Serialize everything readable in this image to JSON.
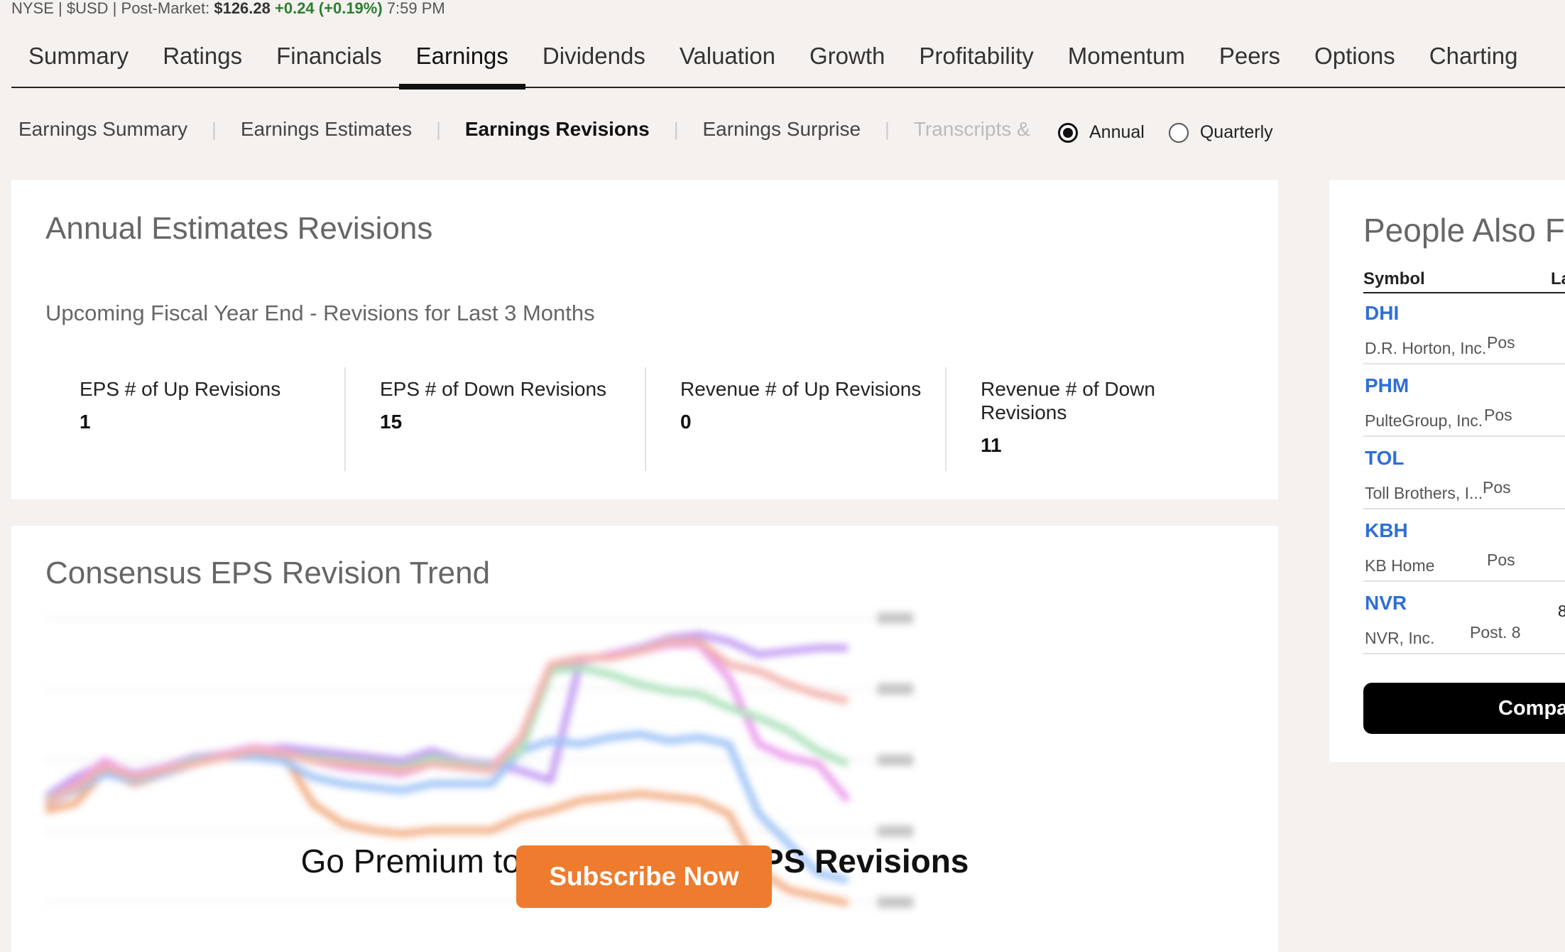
{
  "ticker": {
    "exchange": "NYSE",
    "currency": "$USD",
    "session": "Post-Market:",
    "price": "$126.28",
    "change": "+0.24 (+0.19%)",
    "time": "7:59 PM",
    "change_color": "#2e7d32"
  },
  "main_tabs": [
    "Summary",
    "Ratings",
    "Financials",
    "Earnings",
    "Dividends",
    "Valuation",
    "Growth",
    "Profitability",
    "Momentum",
    "Peers",
    "Options",
    "Charting"
  ],
  "active_main_tab": "Earnings",
  "sub_tabs": [
    "Earnings Summary",
    "Earnings Estimates",
    "Earnings Revisions",
    "Earnings Surprise",
    "Transcripts &"
  ],
  "active_sub_tab": "Earnings Revisions",
  "period_toggle": {
    "annual": "Annual",
    "quarterly": "Quarterly",
    "selected": "Annual"
  },
  "revisions": {
    "title": "Annual Estimates Revisions",
    "subtitle": "Upcoming Fiscal Year End - Revisions for Last 3 Months",
    "metrics": [
      {
        "label": "EPS # of Up Revisions",
        "value": "1"
      },
      {
        "label": "EPS # of Down Revisions",
        "value": "15"
      },
      {
        "label": "Revenue # of Up Revisions",
        "value": "0"
      },
      {
        "label": "Revenue # of Down Revisions",
        "value": "11"
      }
    ]
  },
  "trend": {
    "title": "Consensus EPS Revision Trend",
    "premium_prefix": "Go Premium to see ",
    "premium_bold": "Earnings EPS Revisions",
    "subscribe_label": "Subscribe Now",
    "accent_color": "#ef7c2e"
  },
  "chart_data": {
    "type": "line",
    "title": "Consensus EPS Revision Trend",
    "blurred": true,
    "grid": true,
    "y_ticks_visible": false,
    "series": [
      {
        "color": "#b88cf0",
        "values": [
          26,
          32,
          36,
          33,
          35,
          38,
          39,
          40,
          41,
          40,
          39,
          38,
          37,
          40,
          37,
          36,
          34,
          31,
          67,
          69,
          71,
          74,
          75,
          73,
          69,
          70,
          71,
          71
        ]
      },
      {
        "color": "#f0a070",
        "values": [
          22,
          24,
          34,
          30,
          33,
          36,
          38,
          40,
          39,
          24,
          18,
          16,
          15,
          16,
          16,
          16,
          20,
          22,
          25,
          26,
          27,
          26,
          25,
          21,
          4,
          -2,
          -4,
          -6
        ]
      },
      {
        "color": "#8db8f5",
        "values": [
          24,
          28,
          33,
          31,
          33,
          36,
          38,
          38,
          37,
          32,
          30,
          29,
          28,
          30,
          30,
          30,
          40,
          43,
          42,
          44,
          45,
          43,
          44,
          42,
          21,
          12,
          3,
          1
        ]
      },
      {
        "color": "#e88ce8",
        "values": [
          25,
          30,
          37,
          32,
          35,
          37,
          39,
          41,
          40,
          37,
          35,
          34,
          33,
          36,
          35,
          35,
          44,
          66,
          67,
          69,
          70,
          72,
          72,
          62,
          42,
          38,
          36,
          25
        ]
      },
      {
        "color": "#9fdcb0",
        "values": [
          25,
          29,
          35,
          32,
          34,
          37,
          38,
          40,
          39,
          38,
          37,
          36,
          35,
          38,
          36,
          35,
          40,
          64,
          65,
          63,
          60,
          58,
          57,
          53,
          50,
          46,
          40,
          36
        ]
      },
      {
        "color": "#f0a5a0",
        "values": [
          24,
          29,
          35,
          32,
          34,
          36,
          38,
          40,
          39,
          37,
          36,
          35,
          34,
          36,
          35,
          34,
          44,
          66,
          68,
          68,
          70,
          73,
          73,
          66,
          64,
          60,
          57,
          55
        ]
      }
    ]
  },
  "peers": {
    "title": "People Also Fo",
    "col_symbol": "Symbol",
    "col_last": "La",
    "rows": [
      {
        "symbol": "DHI",
        "name": "D.R. Horton, Inc.",
        "post": "Pos",
        "extra": ""
      },
      {
        "symbol": "PHM",
        "name": "PulteGroup, Inc.",
        "post": "Pos",
        "extra": ""
      },
      {
        "symbol": "TOL",
        "name": "Toll Brothers, I...",
        "post": "Pos",
        "extra": ""
      },
      {
        "symbol": "KBH",
        "name": "KB Home",
        "post": "Pos",
        "extra": ""
      },
      {
        "symbol": "NVR",
        "name": "NVR, Inc.",
        "post": "Post. 8",
        "extra": "8"
      }
    ],
    "compare_label": "Compa",
    "symbol_color": "#2f6fd6"
  }
}
